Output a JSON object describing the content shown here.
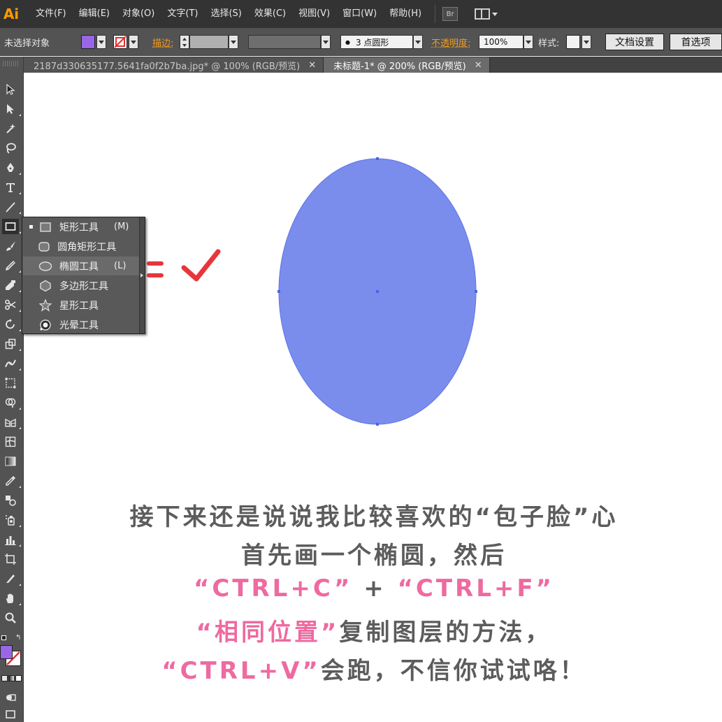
{
  "app": {
    "logo": "Ai",
    "menu": [
      "文件(F)",
      "编辑(E)",
      "对象(O)",
      "文字(T)",
      "选择(S)",
      "效果(C)",
      "视图(V)",
      "窗口(W)",
      "帮助(H)"
    ],
    "bridge_label": "Br"
  },
  "control_bar": {
    "selection_status": "未选择对象",
    "fill_color": "#9966e6",
    "stroke_label": "描边:",
    "brush_value": "3 点圆形",
    "opacity_label": "不透明度:",
    "opacity_value": "100%",
    "style_label": "样式:",
    "doc_setup_button": "文档设置",
    "prefs_button": "首选项"
  },
  "tabs": [
    {
      "title": "2187d330635177.5641fa0f2b7ba.jpg* @ 100% (RGB/预览)",
      "active": false
    },
    {
      "title": "未标题-1* @ 200% (RGB/预览)",
      "active": true
    }
  ],
  "flyout": {
    "items": [
      {
        "label": "矩形工具",
        "shortcut": "(M)",
        "icon": "rectangle-icon",
        "current": true
      },
      {
        "label": "圆角矩形工具",
        "shortcut": "",
        "icon": "rounded-rectangle-icon",
        "current": false
      },
      {
        "label": "椭圆工具",
        "shortcut": "(L)",
        "icon": "ellipse-icon",
        "current": false
      },
      {
        "label": "多边形工具",
        "shortcut": "",
        "icon": "polygon-icon",
        "current": false
      },
      {
        "label": "星形工具",
        "shortcut": "",
        "icon": "star-icon",
        "current": false
      },
      {
        "label": "光晕工具",
        "shortcut": "",
        "icon": "flare-icon",
        "current": false
      }
    ]
  },
  "artwork": {
    "ellipse_color": "#7a8ded",
    "annotation_color": "#e8353b"
  },
  "caption": {
    "line1": "接下来还是说说我比较喜欢的“包子脸”心",
    "line2": "首先画一个椭圆，然后",
    "line3_a": "“CTRL+C”",
    "line3_plus": " + ",
    "line3_b": "“CTRL+F”",
    "line4_a": "“相同位置”",
    "line4_b": "复制图层的方法，",
    "line5_a": "“CTRL+V”",
    "line5_b": "会跑，不信你试试咯！",
    "text_color": "#5c5c5c",
    "accent_color": "#ee6aa0"
  }
}
